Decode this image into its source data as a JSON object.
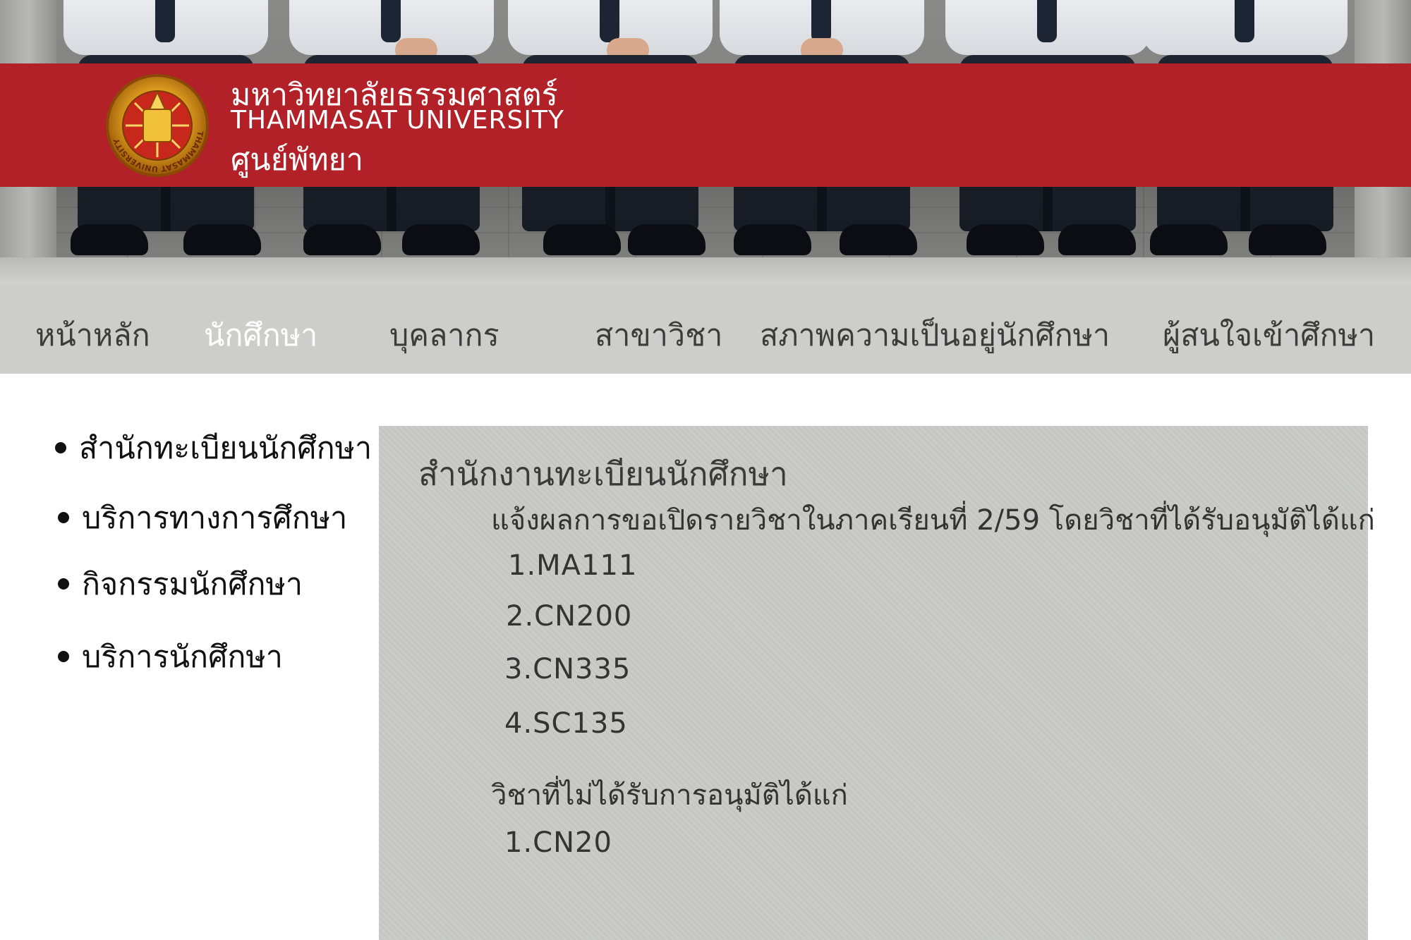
{
  "header": {
    "thai_name": "มหาวิทยาลัยธรรมศาสตร์",
    "english_name": "THAMMASAT UNIVERSITY",
    "campus": "ศูนย์พัทยา",
    "seal_text": "THAMMASAT UNIVERSITY",
    "brand_color": "#b12127"
  },
  "nav": {
    "items": [
      {
        "label": "หน้าหลัก",
        "active": false
      },
      {
        "label": "นักศึกษา",
        "active": true
      },
      {
        "label": "บุคลากร",
        "active": false
      },
      {
        "label": "สาขาวิชา",
        "active": false
      },
      {
        "label": "สภาพความเป็นอยู่นักศึกษา",
        "active": false
      },
      {
        "label": "ผู้สนใจเข้าศึกษา",
        "active": false
      }
    ]
  },
  "sidebar": {
    "items": [
      {
        "label": "สำนักทะเบียนนักศึกษา"
      },
      {
        "label": "บริการทางการศึกษา"
      },
      {
        "label": "กิจกรรมนักศึกษา"
      },
      {
        "label": "บริการนักศึกษา"
      }
    ]
  },
  "content": {
    "title": "สำนักงานทะเบียนนักศึกษา",
    "approved_intro": "แจ้งผลการขอเปิดรายวิชาในภาคเรียนที่ 2/59 โดยวิชาที่ได้รับอนุมัติได้แก่",
    "approved_courses": [
      "1.MA111",
      "2.CN200",
      "3.CN335",
      "4.SC135"
    ],
    "rejected_intro": "วิชาที่ไม่ได้รับการอนุมัติได้แก่",
    "rejected_courses": [
      "1.CN20"
    ]
  }
}
